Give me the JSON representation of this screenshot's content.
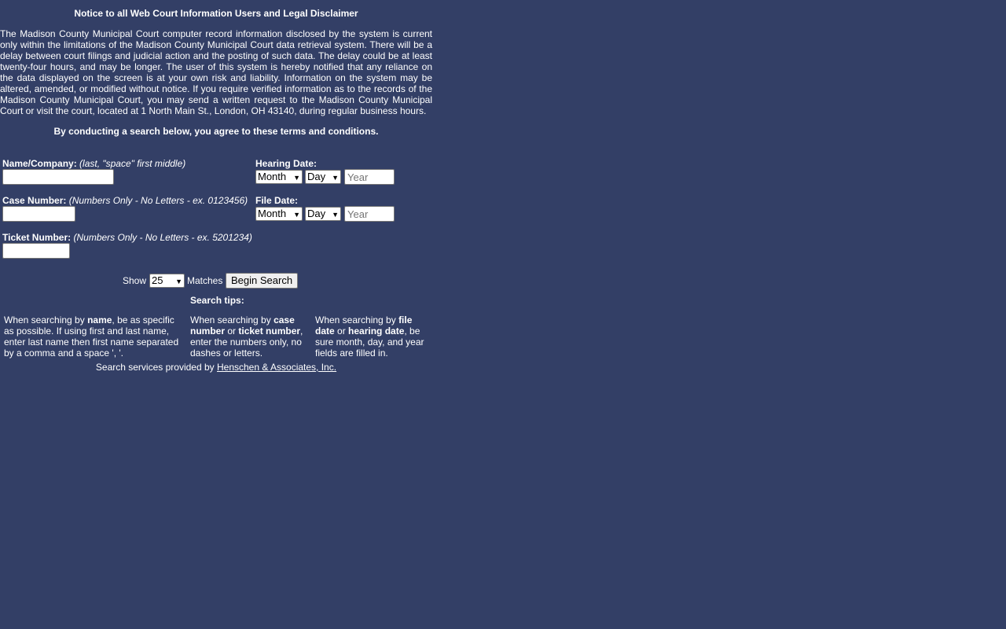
{
  "notice": {
    "title": "Notice to all Web Court Information Users and Legal Disclaimer",
    "body": "The Madison County Municipal Court computer record information disclosed by the system is current only within the limitations of the Madison County Municipal Court data retrieval system. There will be a delay between court filings and judicial action and the posting of such data. The delay could be at least twenty-four hours, and may be longer. The user of this system is hereby notified that any reliance on the data displayed on the screen is at your own risk and liability. Information on the system may be altered, amended, or modified without notice. If you require verified information as to the records of the Madison County Municipal Court, you may send a written request to the Madison County Municipal Court or visit the court, located at 1 North Main St., London, OH 43140, during regular business hours.",
    "agree": "By conducting a search below, you agree to these terms and conditions."
  },
  "form": {
    "name_label": "Name/Company:",
    "name_hint": "(last, \"space\" first middle)",
    "name_value": "",
    "case_label": "Case Number:",
    "case_hint": "(Numbers Only - No Letters - ex. 0123456)",
    "case_value": "",
    "ticket_label": "Ticket Number:",
    "ticket_hint": "(Numbers Only - No Letters - ex. 5201234)",
    "ticket_value": "",
    "hearing_label": "Hearing Date:",
    "file_label": "File Date:",
    "month": "Month",
    "day": "Day",
    "year_placeholder": "Year"
  },
  "search": {
    "show_label": "Show",
    "matches_value": "25",
    "matches_label": "Matches",
    "button": "Begin Search"
  },
  "tips": {
    "heading": "Search tips:",
    "name": {
      "pre": "When searching by ",
      "b1": "name",
      "post": ", be as specific as possible. If using first and last name, enter last name then first name separated by a comma and a space ', '."
    },
    "number": {
      "pre": "When searching by ",
      "b1": "case number",
      "mid": " or ",
      "b2": "ticket number",
      "post": ", enter the numbers only, no dashes or letters."
    },
    "date": {
      "pre": "When searching by ",
      "b1": "file date",
      "mid": " or ",
      "b2": "hearing date",
      "post": ", be sure month, day, and year fields are filled in."
    }
  },
  "footer": {
    "text": "Search services provided by ",
    "link": "Henschen & Associates, Inc."
  }
}
